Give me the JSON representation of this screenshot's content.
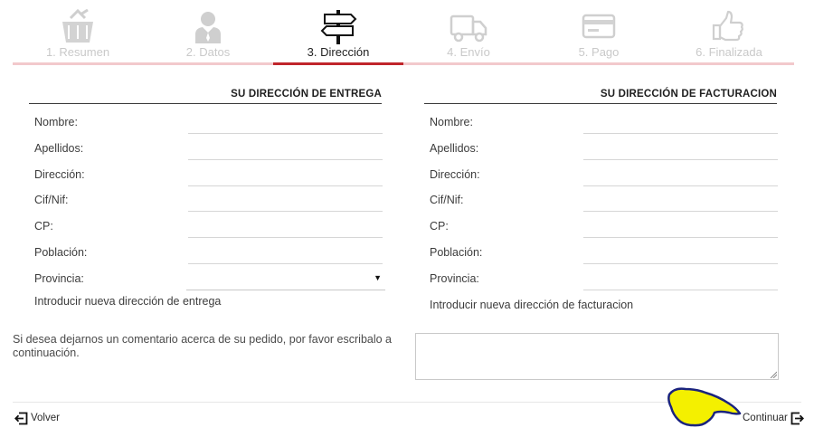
{
  "steps": [
    {
      "label": "1. Resumen",
      "icon": "basket-icon",
      "active": false
    },
    {
      "label": "2. Datos",
      "icon": "user-icon",
      "active": false
    },
    {
      "label": "3. Dirección",
      "icon": "signpost-icon",
      "active": true
    },
    {
      "label": "4. Envío",
      "icon": "truck-icon",
      "active": false
    },
    {
      "label": "5. Pago",
      "icon": "credit-card-icon",
      "active": false
    },
    {
      "label": "6. Finalizada",
      "icon": "thumbs-up-icon",
      "active": false
    }
  ],
  "colors": {
    "accent": "#c0252b",
    "rail": "#f2c9cc",
    "inactive": "#c9c9c9"
  },
  "delivery": {
    "title": "SU DIRECCIÓN DE ENTREGA",
    "fields": {
      "nombre": "Nombre:",
      "apellidos": "Apellidos:",
      "direccion": "Dirección:",
      "cif": "Cif/Nif:",
      "cp": "CP:",
      "poblacion": "Población:",
      "provincia": "Provincia:"
    },
    "values": {
      "nombre": "",
      "apellidos": "",
      "direccion": "",
      "cif": "",
      "cp": "",
      "poblacion": "",
      "provincia": ""
    },
    "new_address": "Introducir nueva dirección de entrega"
  },
  "billing": {
    "title": "SU DIRECCIÓN DE FACTURACION",
    "fields": {
      "nombre": "Nombre:",
      "apellidos": "Apellidos:",
      "direccion": "Dirección:",
      "cif": "Cif/Nif:",
      "cp": "CP:",
      "poblacion": "Población:",
      "provincia": "Provincia:"
    },
    "values": {
      "nombre": "",
      "apellidos": "",
      "direccion": "",
      "cif": "",
      "cp": "",
      "poblacion": "",
      "provincia": ""
    },
    "new_address": "Introducir nueva dirección de facturacion"
  },
  "comment": {
    "prompt": "Si desea dejarnos un comentario acerca de su pedido, por favor escribalo a continuación.",
    "value": ""
  },
  "footer": {
    "back_label": "Volver",
    "next_label": "Continuar"
  }
}
